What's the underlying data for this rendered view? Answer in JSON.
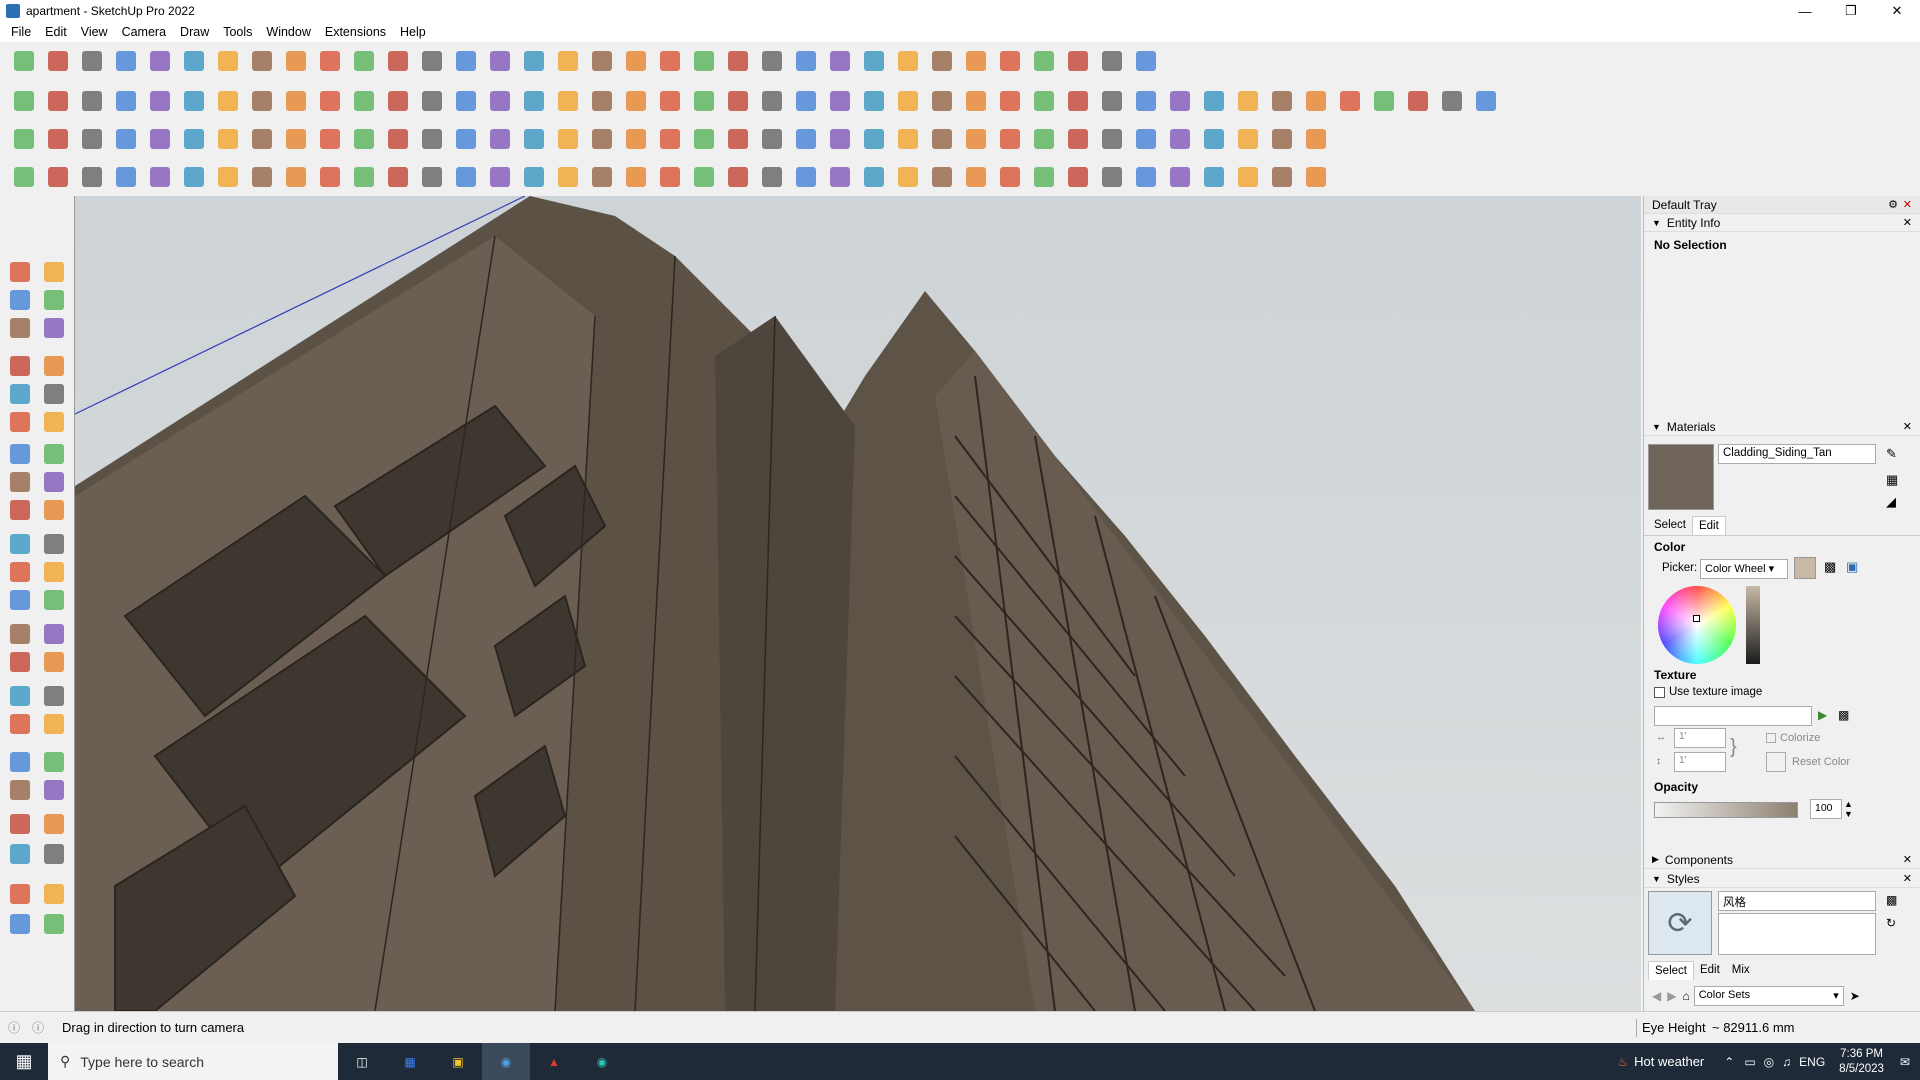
{
  "window": {
    "title": "apartment - SketchUp Pro 2022",
    "minimize_icon": "minimize-icon",
    "maximize_icon": "restore-icon",
    "close_icon": "close-icon"
  },
  "menu": [
    "File",
    "Edit",
    "View",
    "Camera",
    "Draw",
    "Tools",
    "Window",
    "Extensions",
    "Help"
  ],
  "tray": {
    "title": "Default Tray",
    "entity_info": {
      "header": "Entity Info",
      "selection": "No Selection"
    },
    "materials": {
      "header": "Materials",
      "name": "Cladding_Siding_Tan",
      "swatch": "#6e645a",
      "tabs": [
        "Select",
        "Edit"
      ],
      "color_label": "Color",
      "picker_label": "Picker:",
      "picker_value": "Color Wheel",
      "texture_label": "Texture",
      "use_texture_label": "Use texture image",
      "width_value": "1'",
      "height_value": "1'",
      "colorize_label": "Colorize",
      "reset_color_label": "Reset Color",
      "opacity_label": "Opacity",
      "opacity_value": "100"
    },
    "components": {
      "header": "Components"
    },
    "styles": {
      "header": "Styles",
      "name": "风格",
      "tabs": [
        "Select",
        "Edit",
        "Mix"
      ],
      "set": "Color Sets"
    }
  },
  "status": {
    "message": "Drag in direction to turn camera",
    "eye_height_label": "Eye Height",
    "eye_height_value": "~ 82911.6 mm"
  },
  "taskbar": {
    "search_placeholder": "Type here to search",
    "weather": "Hot weather",
    "lang": "ENG",
    "time": "7:36 PM",
    "date": "8/5/2023"
  }
}
